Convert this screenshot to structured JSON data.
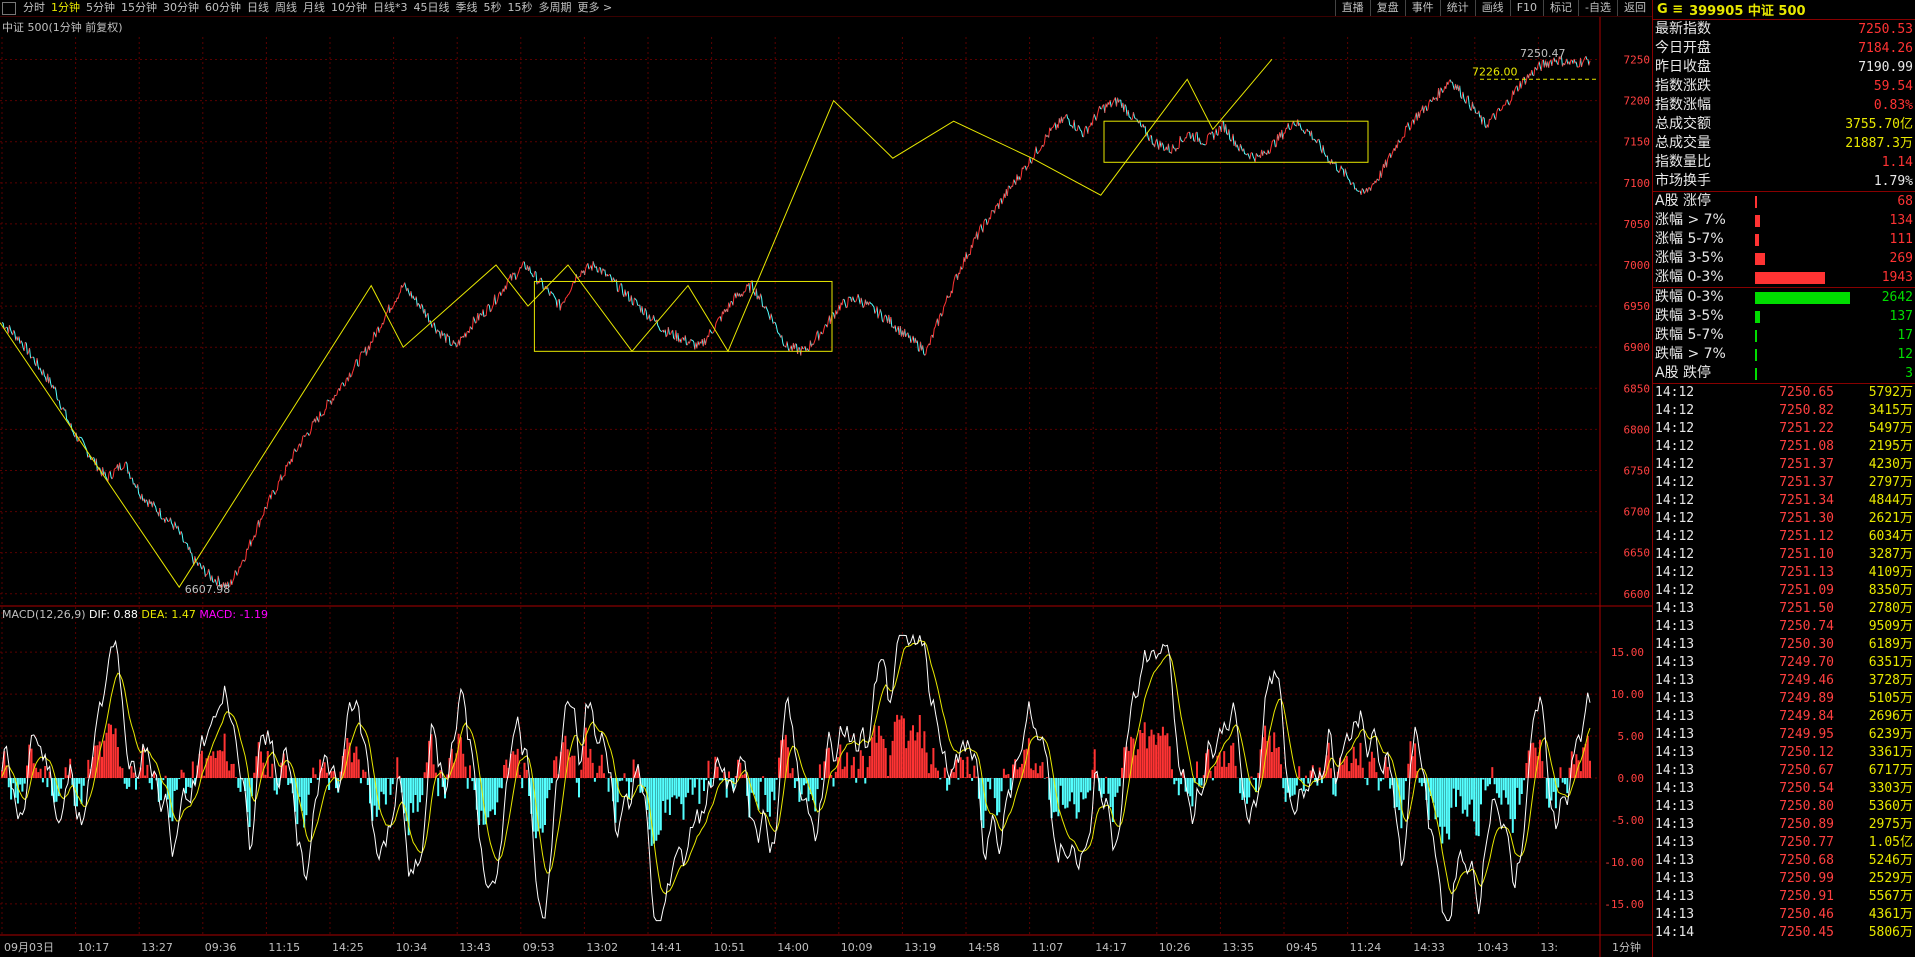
{
  "toolbar": {
    "periods": [
      "分时",
      "1分钟",
      "5分钟",
      "15分钟",
      "30分钟",
      "60分钟",
      "日线",
      "周线",
      "月线",
      "10分钟",
      "日线*3",
      "45日线",
      "季线",
      "5秒",
      "15秒",
      "多周期",
      "更多 >"
    ],
    "active_period": "1分钟",
    "right_buttons": [
      "直播",
      "复盘",
      "事件",
      "统计",
      "画线",
      "F10",
      "标记",
      "-自选",
      "返回"
    ]
  },
  "chart_title": "中证 500(1分钟 前复权)",
  "macd_legend": {
    "name": "MACD(12,26,9)",
    "dif": "DIF: 0.88",
    "dea": "DEA: 1.47",
    "macd": "MACD: -1.19"
  },
  "colors": {
    "up": "#ff3333",
    "down": "#54ffff",
    "dif": "#ffffff",
    "dea": "#e8e800",
    "annotation": "#e8e800",
    "macd_label": "#ff00ff",
    "grid": "#5a0000"
  },
  "chart_data": [
    {
      "type": "line",
      "title": "中证 500(1分钟 前复权)",
      "y_ticks": [
        7250,
        7200,
        7150,
        7100,
        7050,
        7000,
        6950,
        6900,
        6850,
        6800,
        6750,
        6700,
        6650,
        6600
      ],
      "ylim": [
        6590,
        7275
      ],
      "x_tick_labels": [
        "09月03日",
        "10:17",
        "13:27",
        "09:36",
        "11:15",
        "14:25",
        "10:34",
        "13:43",
        "09:53",
        "13:02",
        "14:41",
        "10:51",
        "14:00",
        "10:09",
        "13:19",
        "14:58",
        "11:07",
        "14:17",
        "10:26",
        "13:35",
        "09:45",
        "11:24",
        "14:33",
        "10:43",
        "13:"
      ],
      "x_end_label": "1分钟",
      "annotations": [
        "6607.98",
        "7226.00",
        "7250.47"
      ],
      "zigzag": [
        6930,
        6607.98,
        6975,
        6900,
        7000,
        6950,
        7000,
        6895,
        6975,
        6895,
        7200,
        7130,
        7175,
        7130,
        7085,
        7226,
        7165,
        7250.47
      ],
      "price_series": [
        6930,
        6910,
        6880,
        6850,
        6800,
        6770,
        6740,
        6760,
        6720,
        6700,
        6680,
        6640,
        6620,
        6607.98,
        6650,
        6700,
        6740,
        6780,
        6810,
        6840,
        6870,
        6900,
        6940,
        6975,
        6950,
        6920,
        6900,
        6930,
        6950,
        6980,
        7000,
        6975,
        6950,
        6990,
        7000,
        6980,
        6960,
        6940,
        6920,
        6910,
        6900,
        6930,
        6960,
        6975,
        6940,
        6900,
        6895,
        6920,
        6950,
        6960,
        6945,
        6930,
        6910,
        6895,
        6950,
        7000,
        7040,
        7070,
        7100,
        7130,
        7160,
        7180,
        7160,
        7190,
        7200,
        7175,
        7150,
        7140,
        7160,
        7150,
        7170,
        7140,
        7130,
        7150,
        7175,
        7160,
        7130,
        7110,
        7085,
        7110,
        7150,
        7180,
        7200,
        7226,
        7200,
        7170,
        7190,
        7220,
        7240,
        7250.47,
        7245,
        7250
      ]
    },
    {
      "type": "bar",
      "title": "MACD(12,26,9)",
      "y_ticks": [
        15.0,
        10.0,
        5.0,
        0.0,
        -5.0,
        -10.0,
        -15.0
      ],
      "y_tick_labels": [
        "15.00",
        "10.00",
        "5.00",
        "0.00",
        "-5.00",
        "-10.00",
        "-15.00"
      ],
      "ylim": [
        -18,
        18
      ],
      "dif": 0.88,
      "dea": 1.47,
      "macd": -1.19
    }
  ],
  "panel": {
    "symbol_prefix": "G ≡",
    "symbol": "399905 中证 500",
    "quotes": [
      {
        "label": "最新指数",
        "value": "7250.53",
        "color": "#ff3333"
      },
      {
        "label": "今日开盘",
        "value": "7184.26",
        "color": "#ff3333"
      },
      {
        "label": "昨日收盘",
        "value": "7190.99",
        "color": "#e8e8e8"
      },
      {
        "label": "指数涨跌",
        "value": "59.54",
        "color": "#ff3333"
      },
      {
        "label": "指数涨幅",
        "value": "0.83%",
        "color": "#ff3333"
      },
      {
        "label": "总成交额",
        "value": "3755.70亿",
        "color": "#e8e800"
      },
      {
        "label": "总成交量",
        "value": "21887.3万",
        "color": "#e8e800"
      },
      {
        "label": "指数量比",
        "value": "1.14",
        "color": "#ff3333"
      },
      {
        "label": "市场换手",
        "value": "1.79%",
        "color": "#e8e8e8"
      }
    ],
    "breadth_up": [
      {
        "label": "A股 涨停",
        "value": "68",
        "ratio": 0.02
      },
      {
        "label": "涨幅 > 7%",
        "value": "134",
        "ratio": 0.05
      },
      {
        "label": "涨幅 5-7%",
        "value": "111",
        "ratio": 0.04
      },
      {
        "label": "涨幅 3-5%",
        "value": "269",
        "ratio": 0.1
      },
      {
        "label": "涨幅 0-3%",
        "value": "1943",
        "ratio": 0.74
      }
    ],
    "breadth_down": [
      {
        "label": "跌幅 0-3%",
        "value": "2642",
        "ratio": 1.0
      },
      {
        "label": "跌幅 3-5%",
        "value": "137",
        "ratio": 0.05
      },
      {
        "label": "跌幅 5-7%",
        "value": "17",
        "ratio": 0.01
      },
      {
        "label": "跌幅 > 7%",
        "value": "12",
        "ratio": 0.01
      },
      {
        "label": "A股 跌停",
        "value": "3",
        "ratio": 0.005
      }
    ],
    "ticks": [
      {
        "t": "14:12",
        "p": "7250.65",
        "v": "5792万"
      },
      {
        "t": "14:12",
        "p": "7250.82",
        "v": "3415万"
      },
      {
        "t": "14:12",
        "p": "7251.22",
        "v": "5497万"
      },
      {
        "t": "14:12",
        "p": "7251.08",
        "v": "2195万"
      },
      {
        "t": "14:12",
        "p": "7251.37",
        "v": "4230万"
      },
      {
        "t": "14:12",
        "p": "7251.37",
        "v": "2797万"
      },
      {
        "t": "14:12",
        "p": "7251.34",
        "v": "4844万"
      },
      {
        "t": "14:12",
        "p": "7251.30",
        "v": "2621万"
      },
      {
        "t": "14:12",
        "p": "7251.12",
        "v": "6034万"
      },
      {
        "t": "14:12",
        "p": "7251.10",
        "v": "3287万"
      },
      {
        "t": "14:12",
        "p": "7251.13",
        "v": "4109万"
      },
      {
        "t": "14:12",
        "p": "7251.09",
        "v": "8350万"
      },
      {
        "t": "14:13",
        "p": "7251.50",
        "v": "2780万"
      },
      {
        "t": "14:13",
        "p": "7250.74",
        "v": "9509万"
      },
      {
        "t": "14:13",
        "p": "7250.30",
        "v": "6189万"
      },
      {
        "t": "14:13",
        "p": "7249.70",
        "v": "6351万"
      },
      {
        "t": "14:13",
        "p": "7249.46",
        "v": "3728万"
      },
      {
        "t": "14:13",
        "p": "7249.89",
        "v": "5105万"
      },
      {
        "t": "14:13",
        "p": "7249.84",
        "v": "2696万"
      },
      {
        "t": "14:13",
        "p": "7249.95",
        "v": "6239万"
      },
      {
        "t": "14:13",
        "p": "7250.12",
        "v": "3361万"
      },
      {
        "t": "14:13",
        "p": "7250.67",
        "v": "6717万"
      },
      {
        "t": "14:13",
        "p": "7250.54",
        "v": "3303万"
      },
      {
        "t": "14:13",
        "p": "7250.80",
        "v": "5360万"
      },
      {
        "t": "14:13",
        "p": "7250.89",
        "v": "2975万"
      },
      {
        "t": "14:13",
        "p": "7250.77",
        "v": "1.05亿"
      },
      {
        "t": "14:13",
        "p": "7250.68",
        "v": "5246万"
      },
      {
        "t": "14:13",
        "p": "7250.99",
        "v": "2529万"
      },
      {
        "t": "14:13",
        "p": "7250.91",
        "v": "5567万"
      },
      {
        "t": "14:13",
        "p": "7250.46",
        "v": "4361万"
      },
      {
        "t": "14:14",
        "p": "7250.45",
        "v": "5806万"
      }
    ]
  }
}
